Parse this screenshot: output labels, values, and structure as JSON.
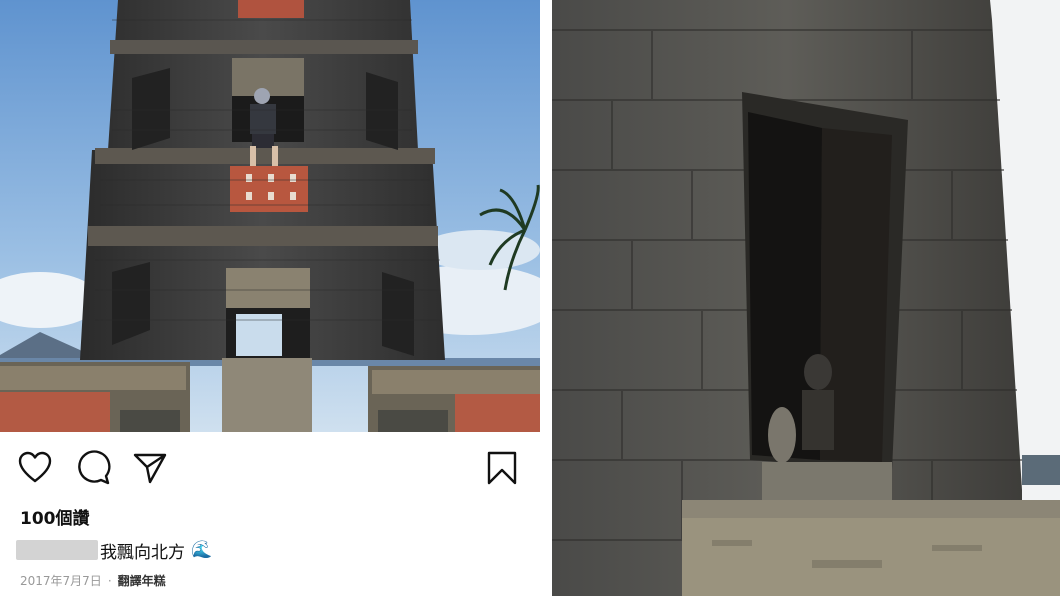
{
  "post": {
    "likes": "100個讚",
    "caption": "我飄向北方",
    "caption_emoji": "🌊",
    "date": "2017年7月7日",
    "separator": "·",
    "translate": "翻譯年糕"
  },
  "icons": {
    "like": "heart-icon",
    "comment": "comment-icon",
    "share": "send-icon",
    "save": "bookmark-icon"
  },
  "colors": {
    "sky": "#6f9fd3",
    "stone": "#3a3a3a",
    "brick": "#b5523b",
    "text": "#111111",
    "meta": "#999999"
  }
}
